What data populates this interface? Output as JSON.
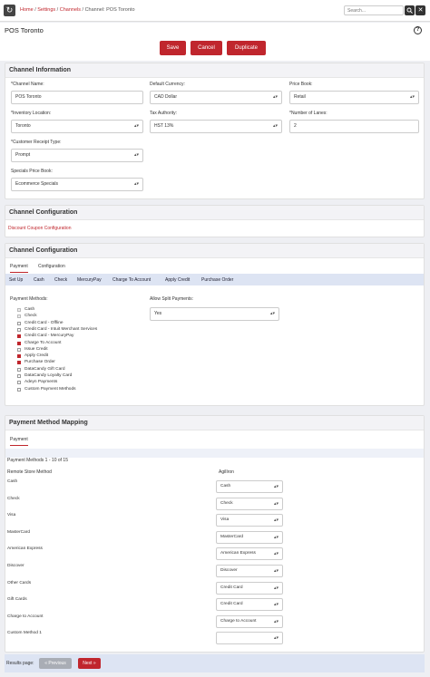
{
  "nav": {
    "breadcrumb": [
      {
        "label": "Home",
        "sep": "/",
        "link": true
      },
      {
        "label": "Settings",
        "sep": "/",
        "link": true
      },
      {
        "label": "Channels",
        "sep": "/",
        "link": true
      },
      {
        "label": "Channel: POS Toronto",
        "sep": "",
        "link": false
      }
    ],
    "search_placeholder": "Search..."
  },
  "header": {
    "title": "POS Toronto",
    "help": "?",
    "buttons": {
      "save": "Save",
      "cancel": "Cancel",
      "duplicate": "Duplicate"
    }
  },
  "channel_info": {
    "title": "Channel Information",
    "channel_name_label": "*Channel Name:",
    "channel_name_value": "POS Toronto",
    "currency_label": "Default Currency:",
    "currency_value": "CAD Dollar",
    "price_book_label": "Price Book:",
    "price_book_value": "Retail",
    "inventory_label": "*Inventory Location:",
    "inventory_value": "Toronto",
    "tax_label": "Tax Authority:",
    "tax_value": "HST 13%",
    "lanes_label": "*Number of Lanes:",
    "lanes_value": "2",
    "receipt_label": "*Customer Receipt Type:",
    "receipt_value": "Prompt",
    "specials_label": "Specials Price Book:",
    "specials_value": "Ecommerce Specials"
  },
  "channel_config_1": {
    "title": "Channel Configuration",
    "link": "Discount Coupon Configuration"
  },
  "channel_config_2": {
    "title": "Channel Configuration",
    "tabs": [
      "Payment",
      "Configuration"
    ],
    "subtabs": [
      "Set Up",
      "Cash",
      "Check",
      "MercuryPay",
      "Charge To Account",
      "Apply Credit",
      "Purchase Order"
    ],
    "payment_methods_label": "Payment Methods:",
    "split_label": "Allow Split Payments:",
    "split_value": "Yes",
    "methods": [
      {
        "label": "Cash",
        "state": "disabled"
      },
      {
        "label": "Check",
        "state": "disabled"
      },
      {
        "label": "Credit Card - Offline",
        "state": "off"
      },
      {
        "label": "Credit Card - Intuit Merchant Services",
        "state": "off"
      },
      {
        "label": "Credit Card - MercuryPay",
        "state": "on"
      },
      {
        "label": "Charge To Account",
        "state": "on"
      },
      {
        "label": "Issue Credit",
        "state": "off"
      },
      {
        "label": "Apply Credit",
        "state": "on"
      },
      {
        "label": "Purchase Order",
        "state": "on"
      },
      {
        "label": "DataCandy Gift Card",
        "state": "off"
      },
      {
        "label": "DataCandy Loyalty Card",
        "state": "off"
      },
      {
        "label": "Adeyn Payments",
        "state": "off"
      },
      {
        "label": "Custom Payment Methods",
        "state": "off"
      }
    ]
  },
  "mapping": {
    "title": "Payment Method Mapping",
    "tab": "Payment",
    "count": "Payment Methods 1 - 10 of 15",
    "col_remote": "Remote Store Method",
    "col_agiliron": "AgilIron",
    "rows": [
      {
        "remote": "Cash",
        "agiliron": "Cash"
      },
      {
        "remote": "Check",
        "agiliron": "Check"
      },
      {
        "remote": "Visa",
        "agiliron": "Visa"
      },
      {
        "remote": "MasterCard",
        "agiliron": "MasterCard"
      },
      {
        "remote": "American Express",
        "agiliron": "American Express"
      },
      {
        "remote": "Discover",
        "agiliron": "Discover"
      },
      {
        "remote": "Other Cards",
        "agiliron": "Credit Card"
      },
      {
        "remote": "Gift Cards",
        "agiliron": "Credit Card"
      },
      {
        "remote": "Charge to Account",
        "agiliron": "Charge to Account"
      },
      {
        "remote": "Custom Method 1",
        "agiliron": ""
      }
    ],
    "results_label": "Results page:",
    "prev": "« Previous",
    "next": "Next »"
  },
  "colors": {
    "accent": "#c0262d",
    "subnav": "#dde4f3"
  }
}
